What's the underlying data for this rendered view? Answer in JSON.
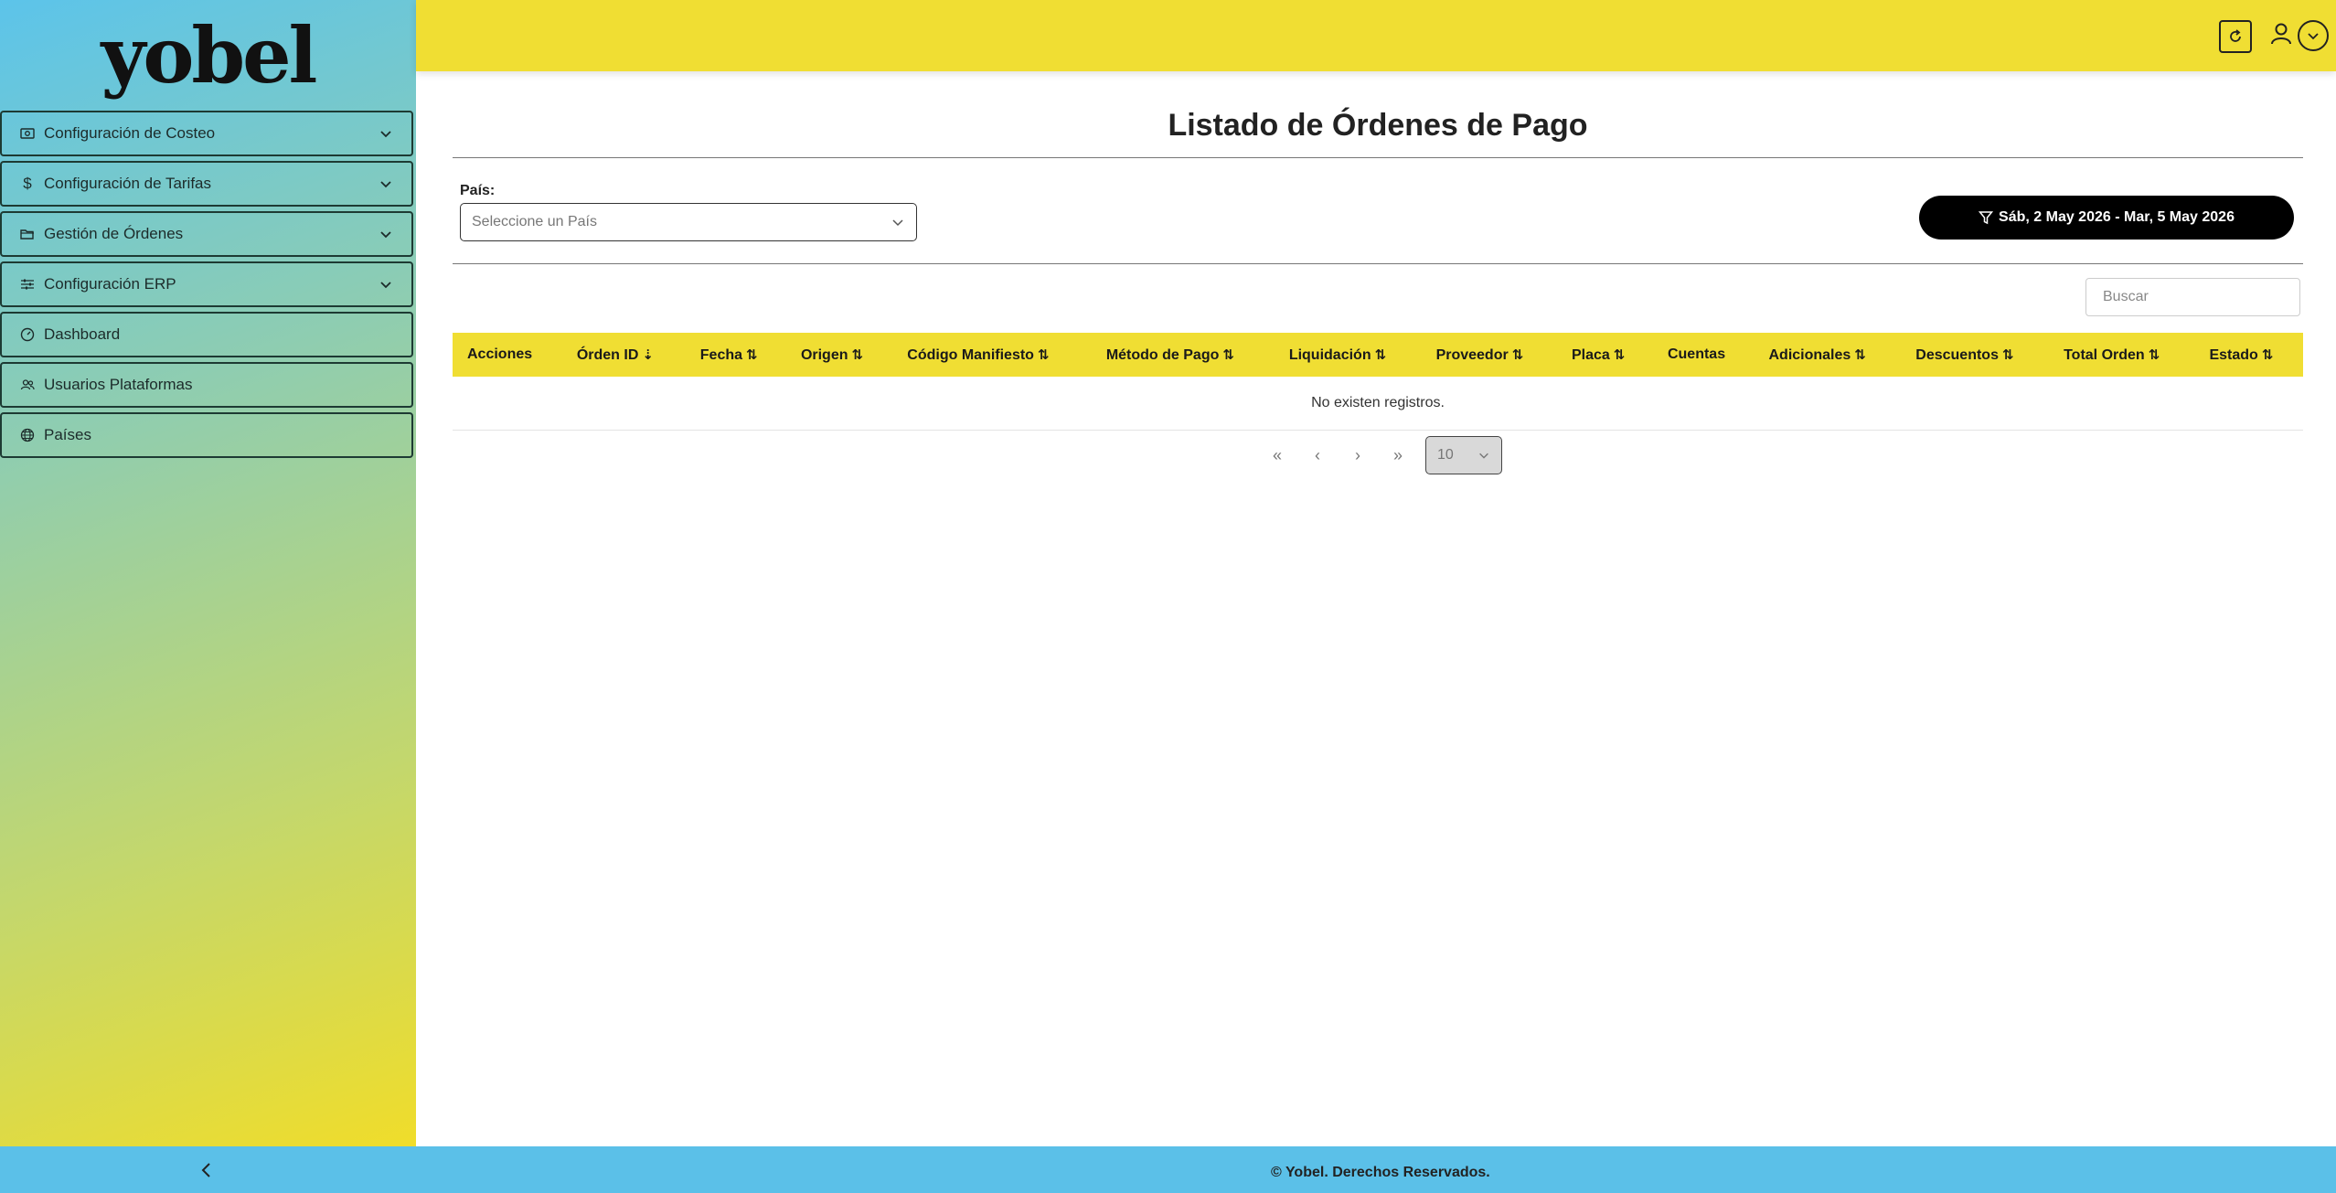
{
  "app": {
    "logo": "yobel"
  },
  "sidebar": {
    "items": [
      {
        "label": "Configuración de Costeo",
        "icon": "cash-icon",
        "expandable": true
      },
      {
        "label": "Configuración de Tarifas",
        "icon": "dollar-icon",
        "expandable": true
      },
      {
        "label": "Gestión de Órdenes",
        "icon": "folder-icon",
        "expandable": true
      },
      {
        "label": "Configuración ERP",
        "icon": "sliders-icon",
        "expandable": true
      },
      {
        "label": "Dashboard",
        "icon": "speedometer-icon",
        "expandable": false
      },
      {
        "label": "Usuarios Plataformas",
        "icon": "users-icon",
        "expandable": false
      },
      {
        "label": "Países",
        "icon": "globe-icon",
        "expandable": false
      }
    ],
    "collapse_icon": "chevron-left-icon"
  },
  "header": {
    "refresh_icon": "refresh-icon",
    "user_icon": "user-icon",
    "user_menu_icon": "chevron-down-icon"
  },
  "main": {
    "title": "Listado de Órdenes de Pago",
    "country_filter": {
      "label": "País:",
      "placeholder": "Seleccione un País"
    },
    "date_range": {
      "label": "Sáb, 2 May 2026 - Mar, 5 May 2026",
      "icon": "filter-icon"
    },
    "search": {
      "placeholder": "Buscar"
    },
    "table": {
      "columns": [
        {
          "label": "Acciones",
          "sort": ""
        },
        {
          "label": "Órden ID",
          "sort": "desc"
        },
        {
          "label": "Fecha",
          "sort": "both"
        },
        {
          "label": "Origen",
          "sort": "both"
        },
        {
          "label": "Código Manifiesto",
          "sort": "both"
        },
        {
          "label": "Método de Pago",
          "sort": "both"
        },
        {
          "label": "Liquidación",
          "sort": "both"
        },
        {
          "label": "Proveedor",
          "sort": "both"
        },
        {
          "label": "Placa",
          "sort": "both"
        },
        {
          "label": "Cuentas",
          "sort": ""
        },
        {
          "label": "Adicionales",
          "sort": "both"
        },
        {
          "label": "Descuentos",
          "sort": "both"
        },
        {
          "label": "Total Orden",
          "sort": "both"
        },
        {
          "label": "Estado",
          "sort": "both"
        }
      ],
      "empty_message": "No existen registros."
    },
    "pagination": {
      "rows_per_page": "10"
    }
  },
  "footer": {
    "text": "© Yobel. Derechos Reservados."
  },
  "colors": {
    "accent_yellow": "#f0de33",
    "footer_blue": "#5bc0e8",
    "button_black": "#000000"
  }
}
